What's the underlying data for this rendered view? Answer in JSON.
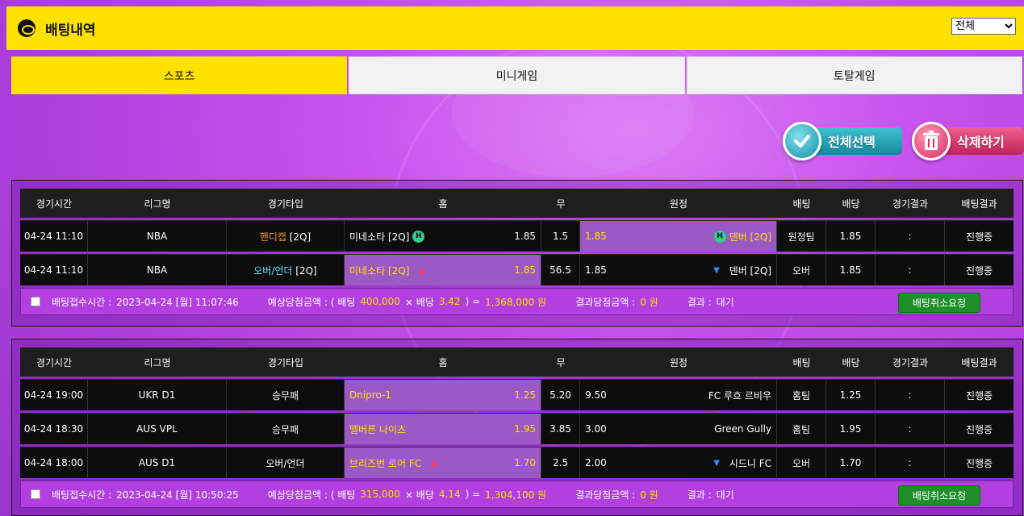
{
  "header": {
    "title": "배팅내역",
    "filter_selected": "전체"
  },
  "tabs": [
    "스포츠",
    "미니게임",
    "토탈게임"
  ],
  "actions": {
    "select_all": "전체선택",
    "delete": "삭제하기"
  },
  "columns": [
    "경기시간",
    "리그명",
    "경기타입",
    "홈",
    "무",
    "원정",
    "배팅",
    "배당",
    "경기결과",
    "배팅결과"
  ],
  "bets": [
    {
      "rows": [
        {
          "time": "04-24 11:10",
          "league": "NBA",
          "type_main": "핸디캡",
          "type_sub": "[2Q]",
          "home_name": "미네소타 [2Q]",
          "home_odds": "1.85",
          "draw": "1.5",
          "away_odds": "1.85",
          "away_name": "덴버 [2Q]",
          "bet": "원정팀",
          "odds": "1.85",
          "result": ":",
          "status": "진행중"
        },
        {
          "time": "04-24 11:10",
          "league": "NBA",
          "type_main": "오버/언더",
          "type_sub": "[2Q]",
          "home_name": "미네소타 [2Q]",
          "home_odds": "1.85",
          "draw": "56.5",
          "away_odds": "1.85",
          "away_name": "덴버 [2Q]",
          "bet": "오버",
          "odds": "1.85",
          "result": ":",
          "status": "진행중"
        }
      ],
      "summary": {
        "accept_label": "배팅접수시간 :",
        "accept_time": "2023-04-24 [월] 11:07:46",
        "expected_label": "예상당첨금액 : ( 배팅",
        "amount": "400,000",
        "times": "× 배당",
        "rate": "3.42",
        "eq": ") =",
        "win": "1,368,000 원",
        "result_label": "결과당첨금액 :",
        "result_value": "0 원",
        "outcome_label": "결과 :",
        "outcome_value": "대기",
        "cancel": "배팅취소요청"
      }
    },
    {
      "rows": [
        {
          "time": "04-24 19:00",
          "league": "UKR D1",
          "type_main": "승무패",
          "type_sub": "",
          "home_name": "Dnipro-1",
          "home_odds": "1.25",
          "draw": "5.20",
          "away_odds": "9.50",
          "away_name": "FC 루흐 르비우",
          "bet": "홈팀",
          "odds": "1.25",
          "result": ":",
          "status": "진행중"
        },
        {
          "time": "04-24 18:30",
          "league": "AUS VPL",
          "type_main": "승무패",
          "type_sub": "",
          "home_name": "멜버른 나이츠",
          "home_odds": "1.95",
          "draw": "3.85",
          "away_odds": "3.00",
          "away_name": "Green Gully",
          "bet": "홈팀",
          "odds": "1.95",
          "result": ":",
          "status": "진행중"
        },
        {
          "time": "04-24 18:00",
          "league": "AUS D1",
          "type_main": "오버/언더",
          "type_sub": "",
          "home_name": "브리즈번 로어 FC",
          "home_odds": "1.70",
          "draw": "2.5",
          "away_odds": "2.00",
          "away_name": "시드니 FC",
          "bet": "오버",
          "odds": "1.70",
          "result": ":",
          "status": "진행중"
        }
      ],
      "summary": {
        "accept_label": "배팅접수시간 :",
        "accept_time": "2023-04-24 [월] 10:50:25",
        "expected_label": "예상당첨금액 : ( 배팅",
        "amount": "315,000",
        "times": "× 배당",
        "rate": "4.14",
        "eq": ") =",
        "win": "1,304,100 원",
        "result_label": "결과당첨금액 :",
        "result_value": "0 원",
        "outcome_label": "결과 :",
        "outcome_value": "대기",
        "cancel": "배팅취소요청"
      }
    }
  ],
  "badges": {
    "handicap": "H"
  },
  "icons": {
    "header": "soccer-ball-icon",
    "select_all": "checkmark-icon",
    "delete": "trash-icon",
    "up": "arrow-up-icon",
    "down": "arrow-down-icon"
  },
  "colors": {
    "accent": "#ffe200",
    "selected": "#9b59c5",
    "cancel": "#1f8f2b",
    "orange": "#f39c32"
  }
}
